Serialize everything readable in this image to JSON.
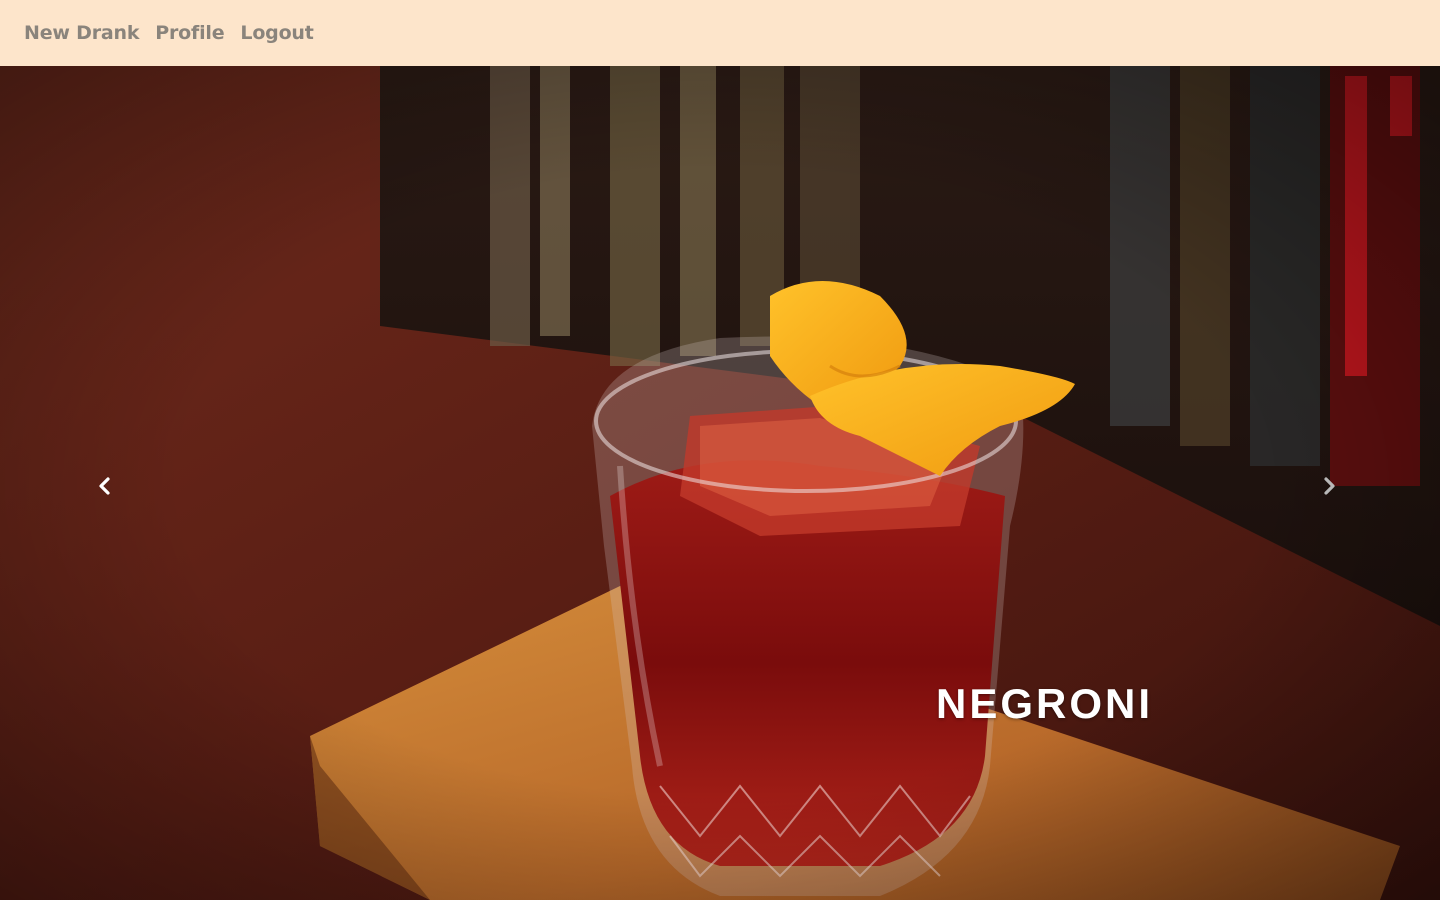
{
  "nav": {
    "items": [
      {
        "label": "New Drank"
      },
      {
        "label": "Profile"
      },
      {
        "label": "Logout"
      }
    ]
  },
  "carousel": {
    "caption": "NEGRONI",
    "prev_icon": "chevron-left-icon",
    "next_icon": "chevron-right-icon"
  },
  "colors": {
    "navbar_bg": "#fde5cb",
    "nav_text": "#8a847c",
    "caption_text": "#ffffff"
  }
}
